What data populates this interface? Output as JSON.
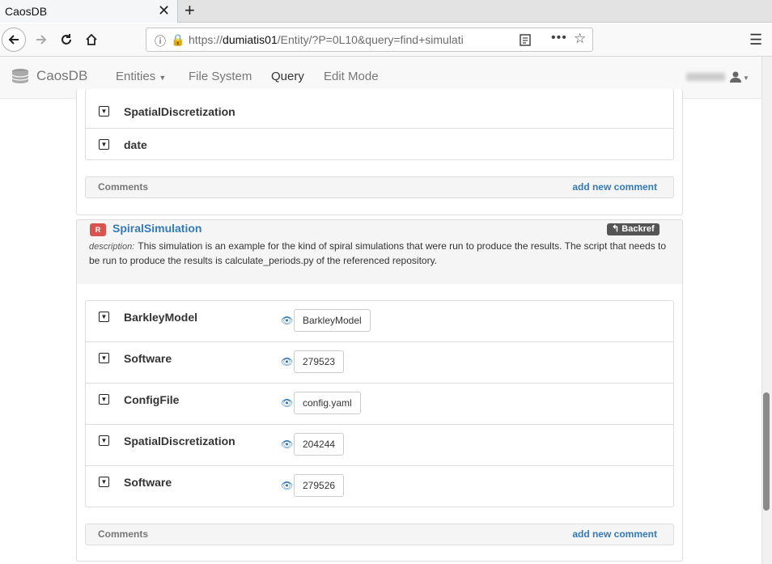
{
  "browser": {
    "tab_title": "CaosDB",
    "tab_close": "✕",
    "new_tab": "+",
    "url_prefix": "https://",
    "url_host": "dumiatis01",
    "url_rest": "/Entity/?P=0L10&query=find+simulati"
  },
  "app": {
    "brand": "CaosDB",
    "nav": {
      "entities": "Entities",
      "file_system": "File System",
      "query": "Query",
      "edit_mode": "Edit Mode"
    }
  },
  "previous_entity": {
    "properties": [
      {
        "name": "SpatialDiscretization"
      },
      {
        "name": "date"
      }
    ],
    "comments_label": "Comments",
    "add_comment_label": "add new comment"
  },
  "entity": {
    "role": "R",
    "name": "SpiralSimulation",
    "backref_label": "Backref",
    "description_label": "description:",
    "description": "This simulation is an example for the kind of spiral simulations that were run to produce the results. The script that needs to be run to produce the results is calculate_periods.py of the referenced repository.",
    "properties": [
      {
        "name": "BarkleyModel",
        "value": "BarkleyModel"
      },
      {
        "name": "Software",
        "value": "279523"
      },
      {
        "name": "ConfigFile",
        "value": "config.yaml"
      },
      {
        "name": "SpatialDiscretization",
        "value": "204244"
      },
      {
        "name": "Software",
        "value": "279526"
      }
    ],
    "comments_label": "Comments",
    "add_comment_label": "add new comment"
  }
}
